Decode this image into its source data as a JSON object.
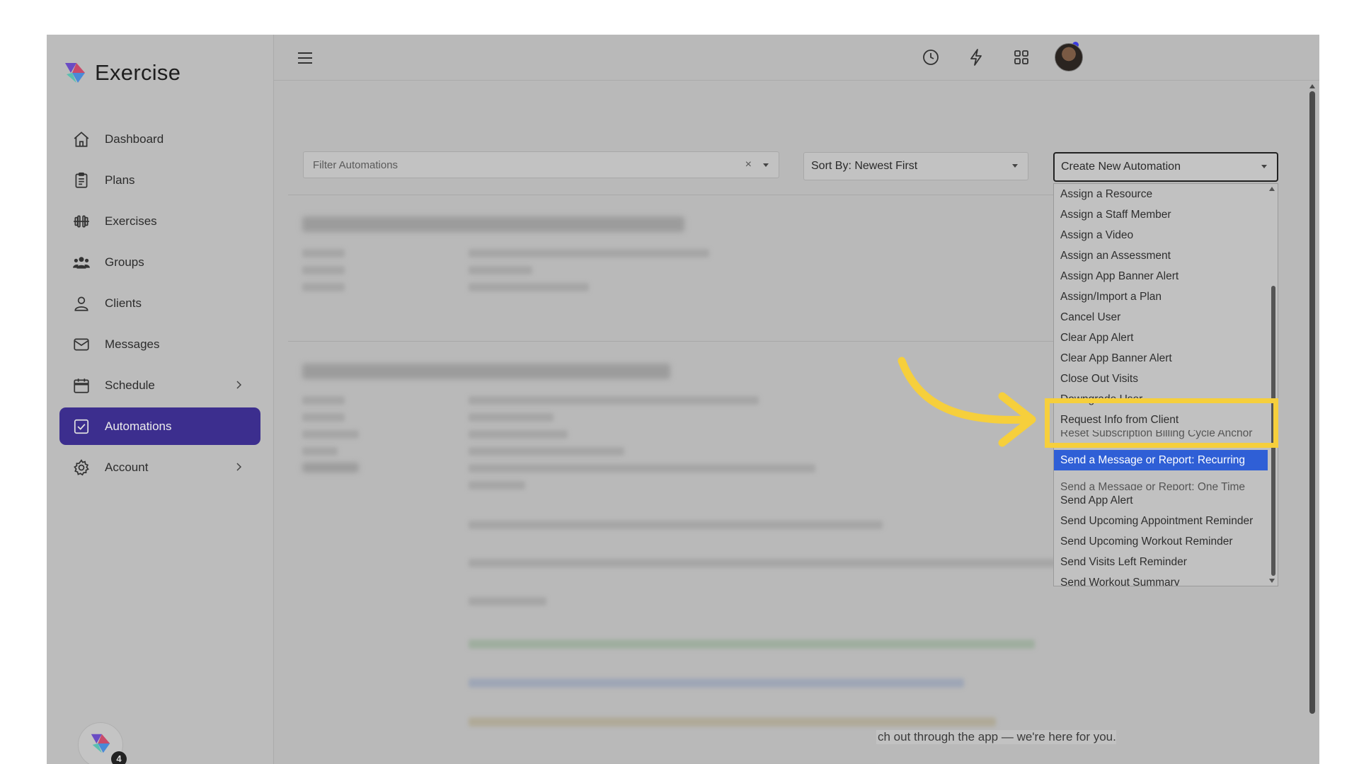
{
  "app": {
    "name": "Exercise",
    "badge_count": "4"
  },
  "sidebar": {
    "items": [
      {
        "label": "Dashboard",
        "icon": "home-icon"
      },
      {
        "label": "Plans",
        "icon": "clipboard-icon"
      },
      {
        "label": "Exercises",
        "icon": "dumbbell-icon"
      },
      {
        "label": "Groups",
        "icon": "users-icon"
      },
      {
        "label": "Clients",
        "icon": "user-icon"
      },
      {
        "label": "Messages",
        "icon": "mail-icon"
      },
      {
        "label": "Schedule",
        "icon": "calendar-icon",
        "has_submenu": true
      },
      {
        "label": "Automations",
        "icon": "checkbox-icon",
        "active": true
      },
      {
        "label": "Account",
        "icon": "gear-icon",
        "has_submenu": true
      }
    ]
  },
  "topbar": {
    "icons": [
      "history-icon",
      "lightning-icon",
      "apps-grid-icon",
      "bell-icon"
    ],
    "notification_dot_color": "#3a3ae0"
  },
  "toolbar": {
    "filter_placeholder": "Filter Automations",
    "filter_clear": "×",
    "sort_label": "Sort By: Newest First",
    "create_label": "Create New Automation"
  },
  "dropdown": {
    "items": [
      "Assign a Resource",
      "Assign a Staff Member",
      "Assign a Video",
      "Assign an Assessment",
      "Assign App Banner Alert",
      "Assign/Import a Plan",
      "Cancel User",
      "Clear App Alert",
      "Clear App Banner Alert",
      "Close Out Visits",
      "Downgrade User",
      "Request Info from Client",
      "Reset Subscription Billing Cycle Anchor",
      "Send a Message or Report: Recurring",
      "Send a Message or Report: One Time",
      "Send App Alert",
      "Send Upcoming Appointment Reminder",
      "Send Upcoming Workout Reminder",
      "Send Visits Left Reminder",
      "Send Workout Summary"
    ],
    "selected": "Send a Message or Report: Recurring"
  },
  "content": {
    "footer_visible_text": "ch out through the app — we're here for you."
  },
  "colors": {
    "accent": "#3c2e8e",
    "selected_option": "#2f5fd6",
    "highlight": "#f6cf3c"
  }
}
